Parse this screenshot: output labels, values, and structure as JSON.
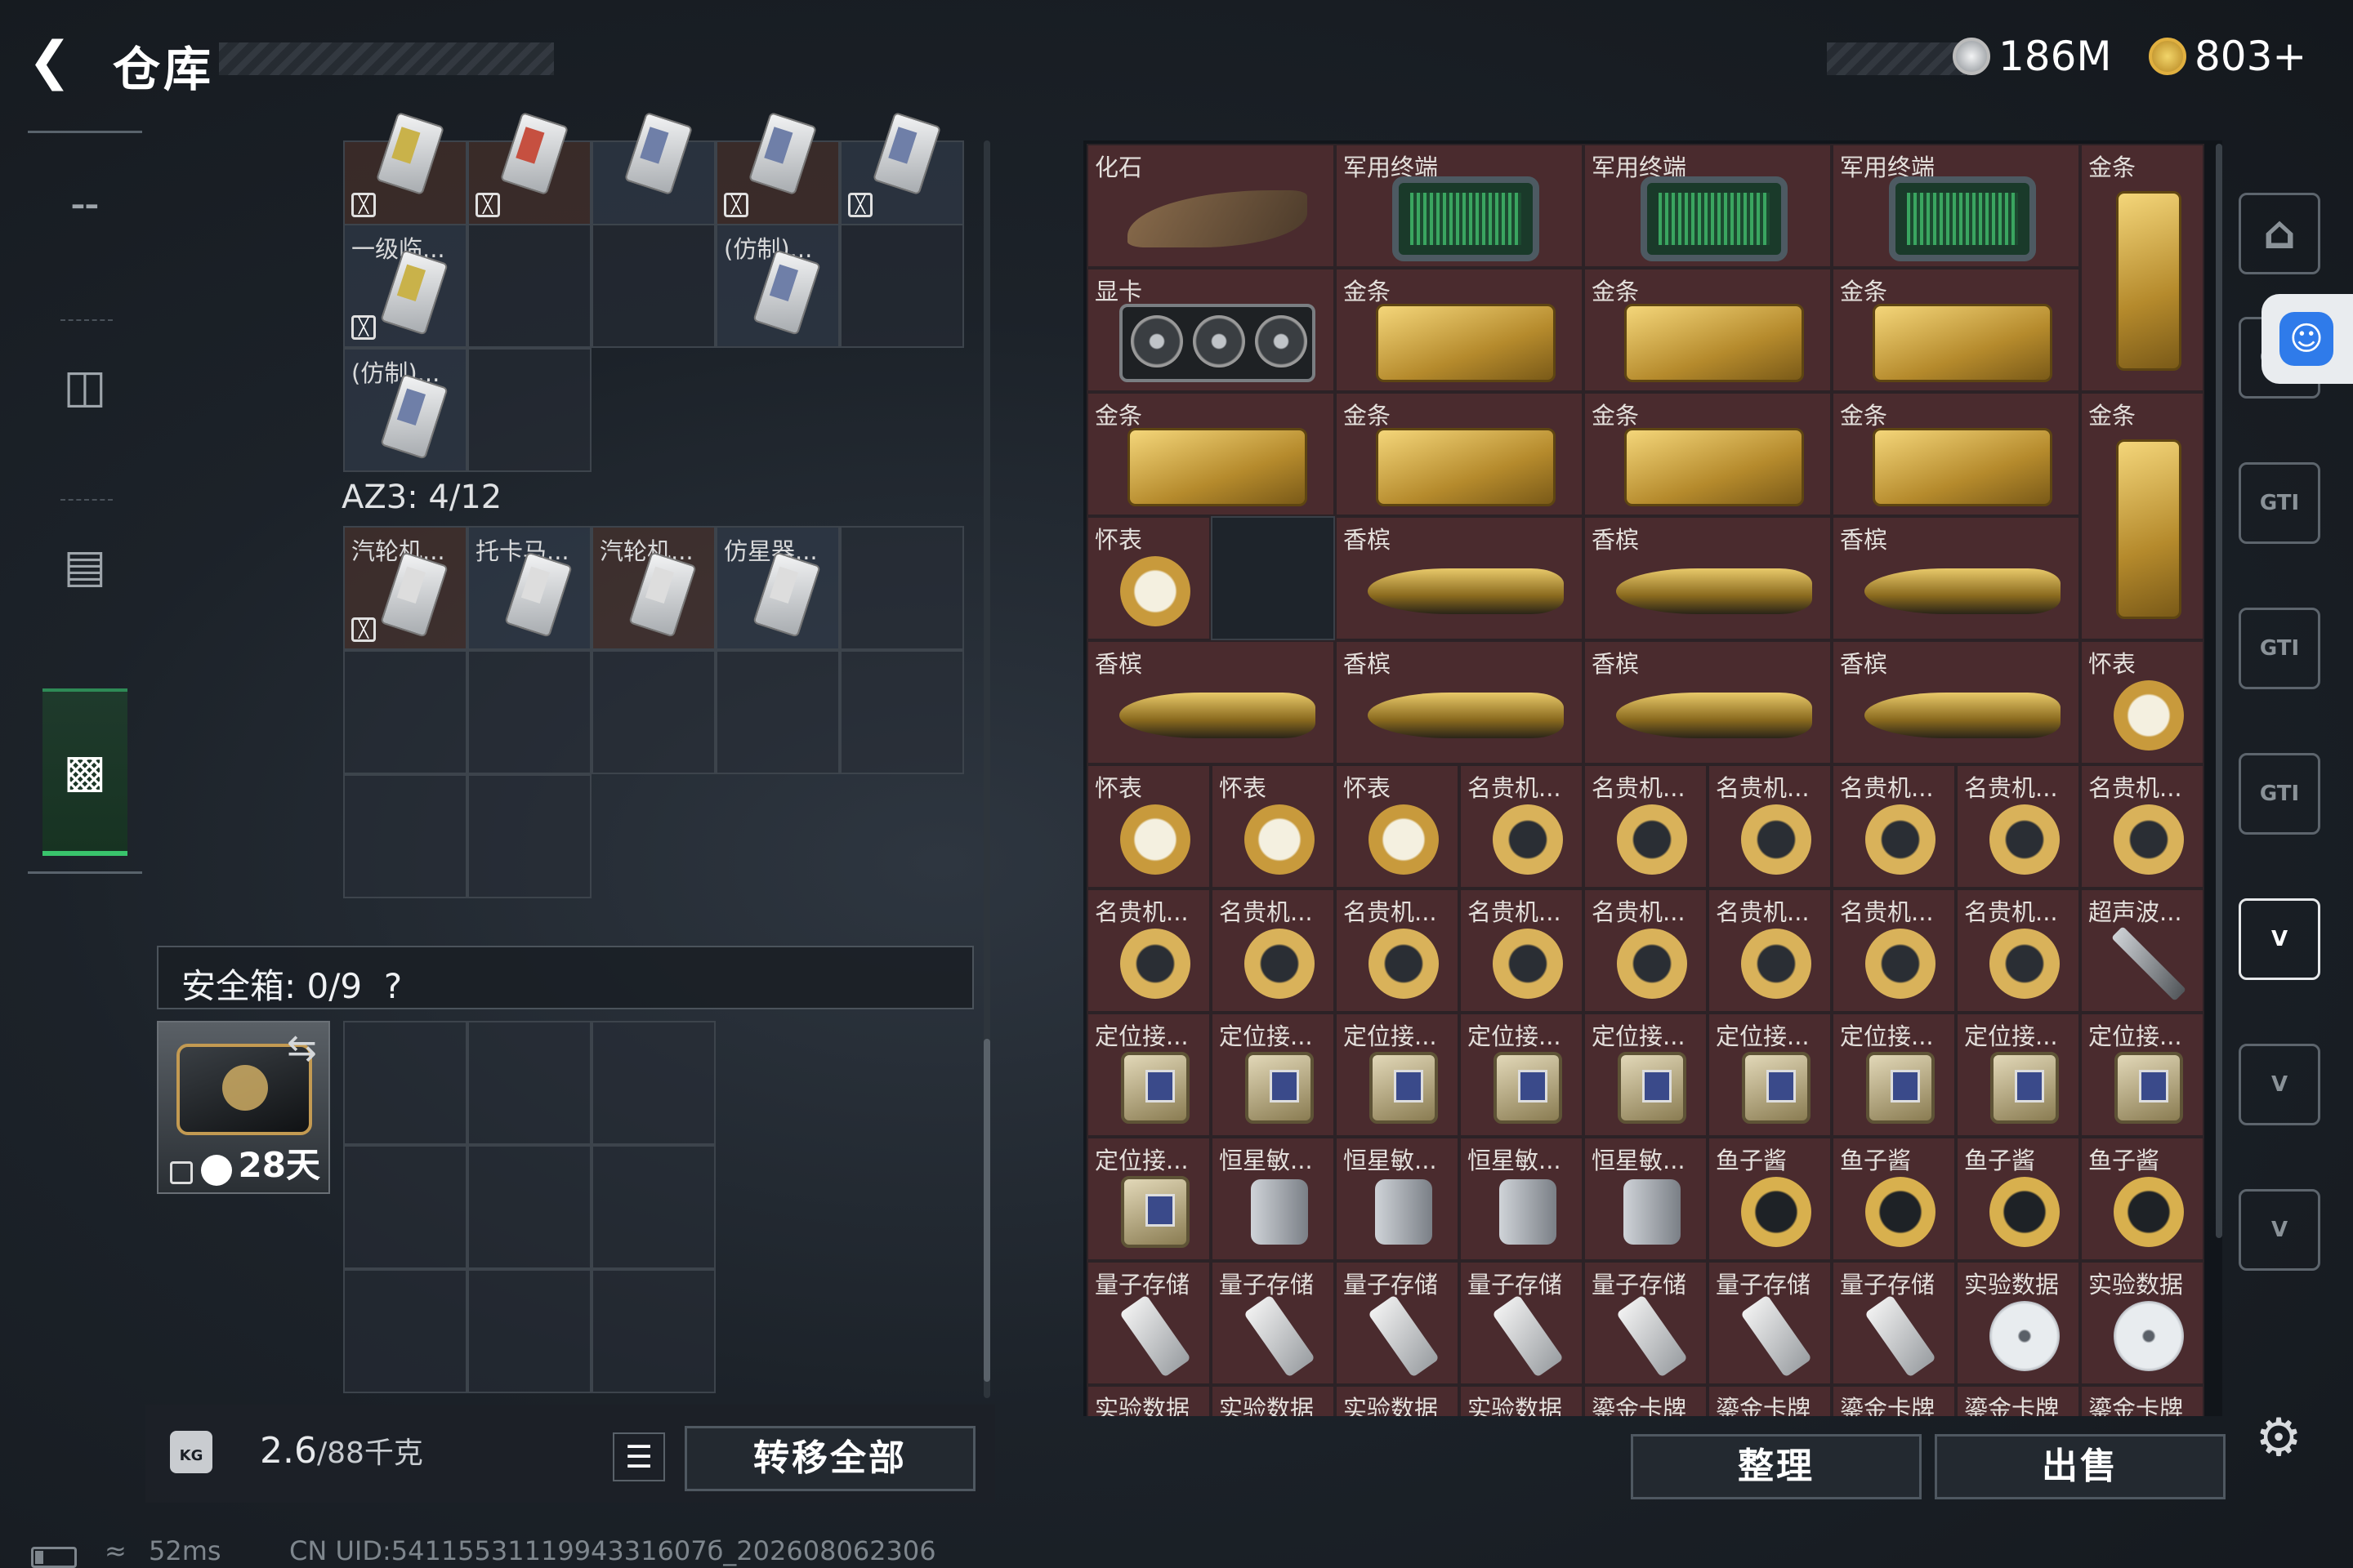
{
  "header": {
    "back_icon": "back-arrow-icon",
    "title": "仓库",
    "currency": [
      {
        "icon": "silver-coin-icon",
        "value": "186M",
        "color": "#c8ccd0"
      },
      {
        "icon": "gold-triangle-coin-icon",
        "value": "803+",
        "color": "#d9a62a"
      }
    ]
  },
  "left_nav": [
    {
      "name": "weapons",
      "icon": "gun-icon"
    },
    {
      "name": "backpack",
      "icon": "backpack-icon"
    },
    {
      "name": "vest",
      "icon": "vest-icon"
    },
    {
      "name": "storage",
      "icon": "briefcase-icon",
      "selected": true
    }
  ],
  "containers": {
    "top_labels": [
      "一级临...",
      "(仿制)...",
      "(仿制)..."
    ],
    "az3": {
      "label": "AZ3: 4/12",
      "items": [
        "汽轮机...",
        "托卡马...",
        "汽轮机...",
        "仿星器..."
      ]
    },
    "safe": {
      "label": "安全箱: 0/9",
      "help": "?",
      "days": "28天"
    }
  },
  "footer_left": {
    "weight_value": "2.6",
    "weight_max": "/88千克",
    "kg_label": "KG",
    "transfer_all": "转移全部"
  },
  "storage_grid": {
    "big_items": [
      {
        "label": "化石",
        "type": "fossil"
      },
      {
        "label": "军用终端",
        "type": "terminal"
      },
      {
        "label": "军用终端",
        "type": "terminal"
      },
      {
        "label": "军用终端",
        "type": "terminal"
      },
      {
        "label": "显卡",
        "type": "gpu"
      },
      {
        "label": "金条",
        "type": "gold"
      },
      {
        "label": "金条",
        "type": "gold"
      },
      {
        "label": "金条",
        "type": "gold"
      },
      {
        "label": "金条",
        "type": "gold"
      },
      {
        "label": "金条",
        "type": "gold"
      },
      {
        "label": "金条",
        "type": "gold"
      },
      {
        "label": "金条",
        "type": "gold"
      },
      {
        "label": "香槟",
        "type": "bottle"
      },
      {
        "label": "香槟",
        "type": "bottle"
      },
      {
        "label": "香槟",
        "type": "bottle"
      },
      {
        "label": "香槟",
        "type": "bottle"
      },
      {
        "label": "香槟",
        "type": "bottle"
      },
      {
        "label": "香槟",
        "type": "bottle"
      },
      {
        "label": "香槟",
        "type": "bottle"
      }
    ],
    "vertical_gold": [
      {
        "label": "金条",
        "type": "gold"
      },
      {
        "label": "金条",
        "type": "gold"
      }
    ],
    "single_items": [
      {
        "label": "怀表",
        "type": "watch"
      },
      {
        "label": "怀表",
        "type": "watch"
      },
      {
        "label": "怀表",
        "type": "watch"
      },
      {
        "label": "怀表",
        "type": "watch"
      },
      {
        "label": "怀表",
        "type": "watch"
      },
      {
        "label": "名贵机...",
        "type": "rolex"
      },
      {
        "label": "名贵机...",
        "type": "rolex"
      },
      {
        "label": "名贵机...",
        "type": "rolex"
      },
      {
        "label": "名贵机...",
        "type": "rolex"
      },
      {
        "label": "名贵机...",
        "type": "rolex"
      },
      {
        "label": "名贵机...",
        "type": "rolex"
      },
      {
        "label": "名贵机...",
        "type": "rolex"
      },
      {
        "label": "名贵机...",
        "type": "rolex"
      },
      {
        "label": "名贵机...",
        "type": "rolex"
      },
      {
        "label": "名贵机...",
        "type": "rolex"
      },
      {
        "label": "名贵机...",
        "type": "rolex"
      },
      {
        "label": "名贵机...",
        "type": "rolex"
      },
      {
        "label": "名贵机...",
        "type": "rolex"
      },
      {
        "label": "名贵机...",
        "type": "rolex"
      },
      {
        "label": "超声波...",
        "type": "ultra"
      },
      {
        "label": "定位接...",
        "type": "locator"
      },
      {
        "label": "定位接...",
        "type": "locator"
      },
      {
        "label": "定位接...",
        "type": "locator"
      },
      {
        "label": "定位接...",
        "type": "locator"
      },
      {
        "label": "定位接...",
        "type": "locator"
      },
      {
        "label": "定位接...",
        "type": "locator"
      },
      {
        "label": "定位接...",
        "type": "locator"
      },
      {
        "label": "定位接...",
        "type": "locator"
      },
      {
        "label": "定位接...",
        "type": "locator"
      },
      {
        "label": "定位接...",
        "type": "locator"
      },
      {
        "label": "恒星敏...",
        "type": "star"
      },
      {
        "label": "恒星敏...",
        "type": "star"
      },
      {
        "label": "恒星敏...",
        "type": "star"
      },
      {
        "label": "恒星敏...",
        "type": "star"
      },
      {
        "label": "鱼子酱",
        "type": "caviar"
      },
      {
        "label": "鱼子酱",
        "type": "caviar"
      },
      {
        "label": "鱼子酱",
        "type": "caviar"
      },
      {
        "label": "鱼子酱",
        "type": "caviar"
      },
      {
        "label": "量子存储",
        "type": "usb"
      },
      {
        "label": "量子存储",
        "type": "usb"
      },
      {
        "label": "量子存储",
        "type": "usb"
      },
      {
        "label": "量子存储",
        "type": "usb"
      },
      {
        "label": "量子存储",
        "type": "usb"
      },
      {
        "label": "量子存储",
        "type": "usb"
      },
      {
        "label": "量子存储",
        "type": "usb"
      },
      {
        "label": "实验数据",
        "type": "disc"
      },
      {
        "label": "实验数据",
        "type": "disc"
      },
      {
        "label": "实验数据",
        "type": "disc"
      },
      {
        "label": "实验数据",
        "type": "disc"
      },
      {
        "label": "实验数据",
        "type": "disc"
      },
      {
        "label": "实验数据",
        "type": "disc"
      },
      {
        "label": "鎏金卡牌",
        "type": "card"
      },
      {
        "label": "鎏金卡牌",
        "type": "card"
      },
      {
        "label": "鎏金卡牌",
        "type": "card"
      },
      {
        "label": "鎏金卡牌",
        "type": "card"
      },
      {
        "label": "鎏金卡牌",
        "type": "card"
      },
      {
        "label": "鎏金卡牌",
        "type": "card"
      }
    ]
  },
  "right_nav": [
    "home-icon",
    "GTI",
    "GTI",
    "GTI",
    "GTI",
    "V",
    "V",
    "V"
  ],
  "actions": {
    "sort": "整理",
    "sell": "出售"
  },
  "status": {
    "ping": "52ms",
    "uid": "CN UID:5411553111994331607б_202608062306"
  },
  "colors": {
    "item_bg": "#4a2b2e",
    "selected_nav": "#39c46c",
    "accessibility": "#2f7bea"
  }
}
